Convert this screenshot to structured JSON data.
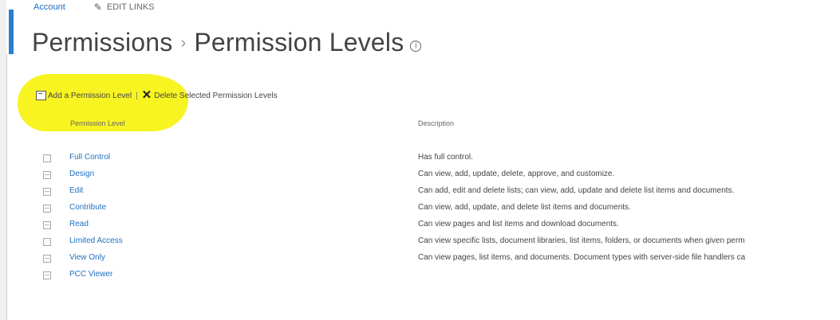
{
  "nav": {
    "crumb": "Account",
    "edit_links": "EDIT LINKS"
  },
  "title": {
    "parent": "Permissions",
    "separator": "›",
    "current": "Permission Levels",
    "info_glyph": "i"
  },
  "toolbar": {
    "add_label": "Add a Permission Level",
    "divider": "|",
    "delete_label": "Delete Selected Permission Levels"
  },
  "table": {
    "headers": {
      "level": "Permission Level",
      "description": "Description"
    },
    "rows": [
      {
        "name": "Full Control",
        "description": "Has full control."
      },
      {
        "name": "Design",
        "description": "Can view, add, update, delete, approve, and customize."
      },
      {
        "name": "Edit",
        "description": "Can add, edit and delete lists; can view, add, update and delete list items and documents."
      },
      {
        "name": "Contribute",
        "description": "Can view, add, update, and delete list items and documents."
      },
      {
        "name": "Read",
        "description": "Can view pages and list items and download documents."
      },
      {
        "name": "Limited Access",
        "description": "Can view specific lists, document libraries, list items, folders, or documents when given perm"
      },
      {
        "name": "View Only",
        "description": "Can view pages, list items, and documents. Document types with server-side file handlers ca"
      },
      {
        "name": "PCC Viewer",
        "description": ""
      }
    ]
  },
  "colors": {
    "accent": "#2a7dd1",
    "link": "#1f6fbf",
    "highlight": "#f7f316"
  }
}
